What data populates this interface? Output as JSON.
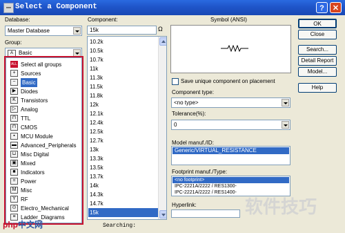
{
  "window": {
    "title": "Select a Component",
    "help_glyph": "?",
    "close_glyph": "✕"
  },
  "left": {
    "database_label": "Database:",
    "database_value": "Master Database",
    "group_label": "Group:",
    "group_value": "Basic",
    "group_icon_text": "A",
    "groups": [
      {
        "icon": "ALL",
        "label": "Select all groups",
        "color": "#c8102e"
      },
      {
        "icon": "+",
        "label": "Sources"
      },
      {
        "icon": "~",
        "label": "Basic",
        "selected": true
      },
      {
        "icon": "▶",
        "label": "Diodes"
      },
      {
        "icon": "K",
        "label": "Transistors"
      },
      {
        "icon": "▷",
        "label": "Analog"
      },
      {
        "icon": "⊓",
        "label": "TTL"
      },
      {
        "icon": "⊓",
        "label": "CMOS"
      },
      {
        "icon": "▪",
        "label": "MCU Module"
      },
      {
        "icon": "▬",
        "label": "Advanced_Peripherals"
      },
      {
        "icon": "⊔",
        "label": "Misc Digital"
      },
      {
        "icon": "▣",
        "label": "Mixed"
      },
      {
        "icon": "■",
        "label": "Indicators"
      },
      {
        "icon": "=",
        "label": "Power"
      },
      {
        "icon": "M",
        "label": "Misc"
      },
      {
        "icon": "Y",
        "label": "RF"
      },
      {
        "icon": "⊙",
        "label": "Electro_Mechanical"
      },
      {
        "icon": "≡",
        "label": "Ladder_Diagrams"
      }
    ]
  },
  "component": {
    "label": "Component:",
    "value": "15k",
    "search_glyph": "Ω",
    "items": [
      "10.2k",
      "10.5k",
      "10.7k",
      "11k",
      "11.3k",
      "11.5k",
      "11.8k",
      "12k",
      "12.1k",
      "12.4k",
      "12.5k",
      "12.7k",
      "13k",
      "13.3k",
      "13.5k",
      "13.7k",
      "14k",
      "14.3k",
      "14.7k",
      "15k"
    ]
  },
  "symbol": {
    "label": "Symbol (ANSI)"
  },
  "save_unique_label": "Save unique component on placement",
  "component_type": {
    "label": "Component type:",
    "value": "<no type>"
  },
  "tolerance": {
    "label": "Tolerance(%):",
    "value": "0"
  },
  "model_manuf": {
    "label": "Model manuf./ID:",
    "value": "Generic/VIRTUAL_RESISTANCE"
  },
  "footprint": {
    "label": "Footprint manuf./Type:",
    "items": [
      "<no footprint>",
      "IPC-2221A/2222 / RES1300-",
      "IPC-2221A/2222 / RES1400-"
    ]
  },
  "hyperlink_label": "Hyperlink:",
  "buttons": [
    {
      "label": "OK",
      "key": "ok"
    },
    {
      "label": "Close",
      "key": "close"
    },
    {
      "label": "Search...",
      "key": "search"
    },
    {
      "label": "Detail Report",
      "key": "detail"
    },
    {
      "label": "Model...",
      "key": "model"
    },
    {
      "label": "Help",
      "key": "help"
    }
  ],
  "status": "Searching:",
  "watermark": "软件技巧",
  "logo": {
    "php": "php",
    "cn": "中文网"
  },
  "colors": {
    "title_bar": "#1f55c9",
    "selection": "#316ac5",
    "highlight_frame": "#c8102e"
  }
}
